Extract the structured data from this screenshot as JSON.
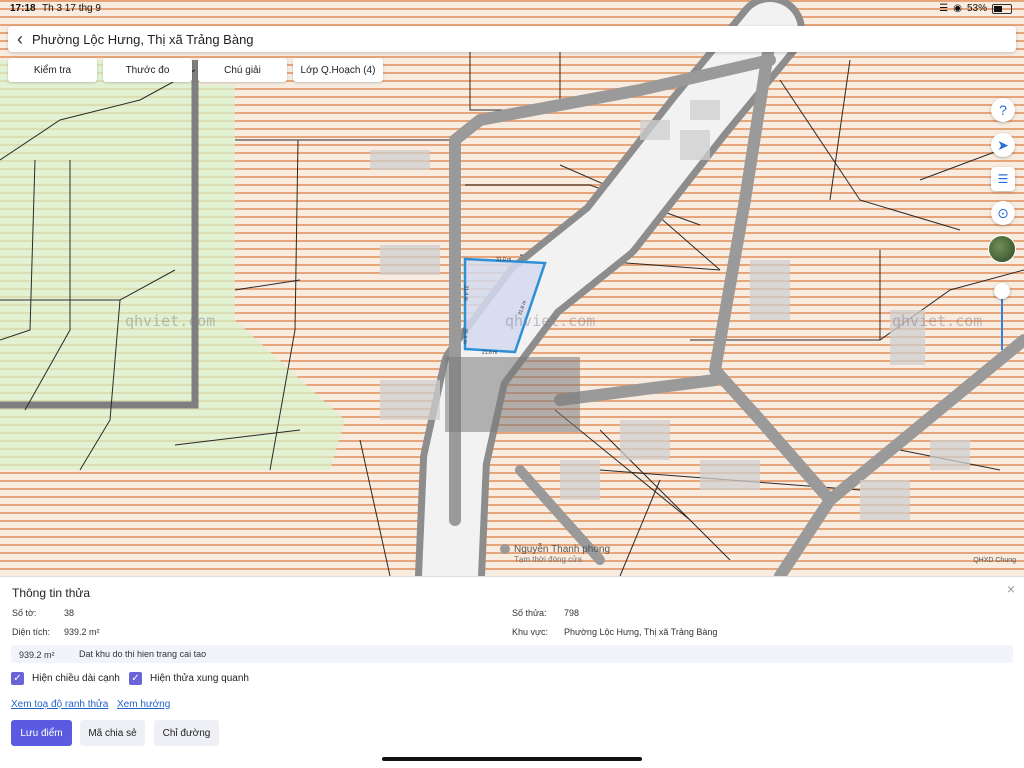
{
  "status": {
    "time": "17:18",
    "date": "Th 3 17 thg 9",
    "battery": "53%",
    "battery_fraction": 0.53
  },
  "header": {
    "back_icon": "chevron-left-icon",
    "title": "Phường Lộc Hưng, Thị xã Trảng Bàng"
  },
  "tabs": [
    {
      "label": "Kiểm tra"
    },
    {
      "label": "Thước đo"
    },
    {
      "label": "Chú giải"
    },
    {
      "label": "Lớp Q.Hoạch (4)"
    }
  ],
  "map": {
    "watermarks": [
      "qhviet.com",
      "qhviet.com",
      "qhviet.com"
    ],
    "place_label": "Nguyễn Thanh phong",
    "place_sub": "Tạm thời đóng cửa",
    "credit": "QHXD Chung",
    "parcel_dims": [
      "31.0 m",
      "21.4 m",
      "31.8 m",
      "25.4 m",
      "21.6 m"
    ],
    "colors": {
      "zone_stripe": "#e6a57a",
      "green_zone": "#d6f0c8",
      "road": "#8d8d8d",
      "parcel_outline": "#2f8fd6"
    }
  },
  "controls": [
    "question-icon",
    "compass-icon",
    "layers-icon",
    "locate-icon",
    "satellite-icon"
  ],
  "panel": {
    "heading": "Thông tin thửa",
    "so_to_label": "Số tờ:",
    "so_to": "38",
    "so_thua_label": "Số thửa:",
    "so_thua": "798",
    "dien_tich_label": "Diện tích:",
    "dien_tich": "939.2 m²",
    "khu_vuc_label": "Khu vực:",
    "khu_vuc": "Phường Lộc Hưng, Thị xã Trảng Bàng",
    "band_area": "939.2 m²",
    "band_desc": "Dat khu do thi hien trang cai tao",
    "check1": "Hiện chiều dài cạnh",
    "check2": "Hiện thửa xung quanh",
    "link1": "Xem toạ độ ranh thửa",
    "link2": "Xem hướng",
    "btn_save": "Lưu điểm",
    "btn_share": "Mã chia sẻ",
    "btn_route": "Chỉ đường"
  }
}
